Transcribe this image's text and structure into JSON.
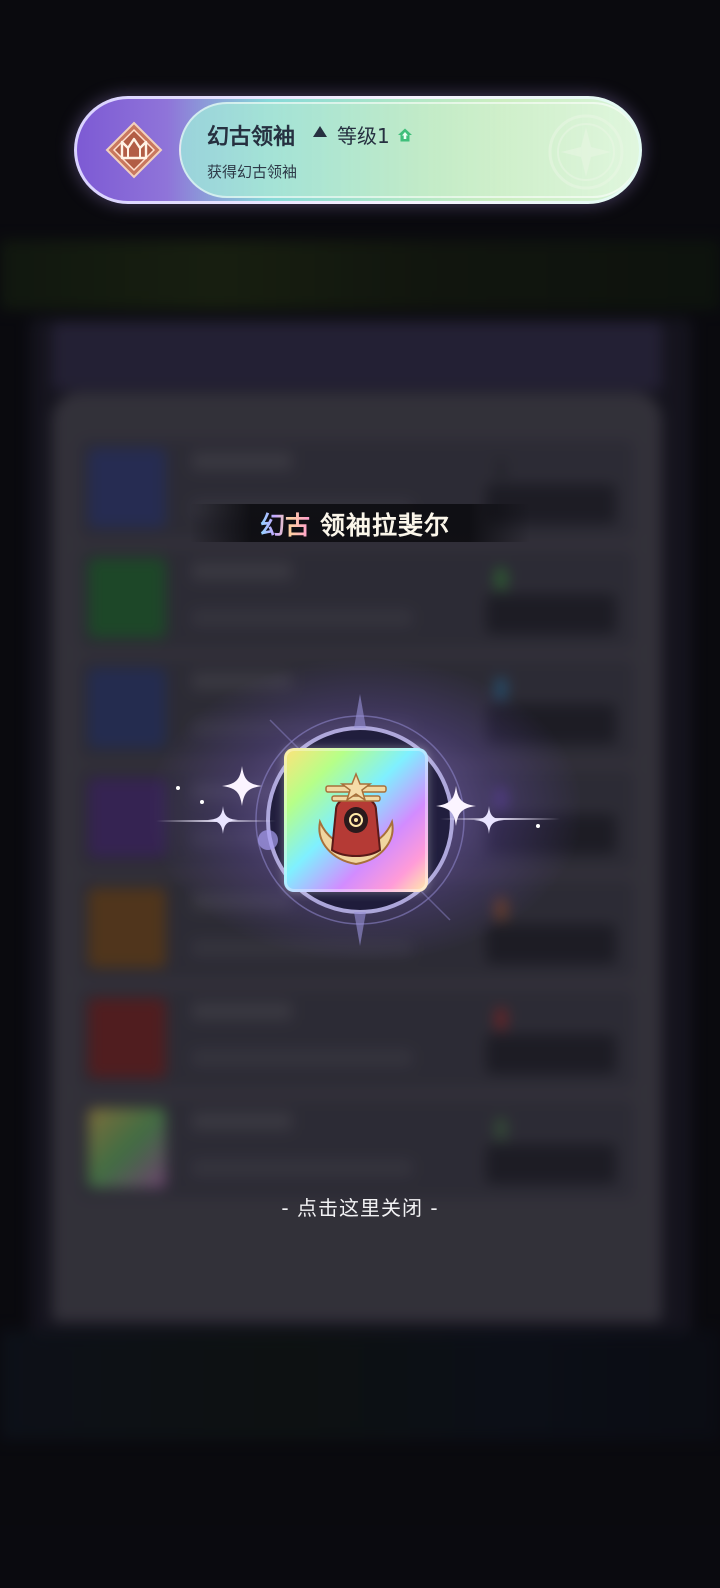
{
  "banner": {
    "title": "幻古领袖",
    "level": "等级1",
    "subtitle": "获得幻古领袖"
  },
  "reward": {
    "name_prefix": "幻古",
    "name_main": "领袖拉斐尔"
  },
  "close_hint": "- 点击这里关闭 -",
  "colors": {
    "banner_purple": "#7d5ad4",
    "banner_mint": "#a9e5c8",
    "text_dark": "#263040",
    "glow": "#aa8cff"
  },
  "icons": {
    "banner_badge": "leader-rank-badge-icon",
    "level_up": "house-arrow-icon",
    "banner_emblem": "star-emblem-icon",
    "reward_item": "hooded-leader-icon"
  }
}
